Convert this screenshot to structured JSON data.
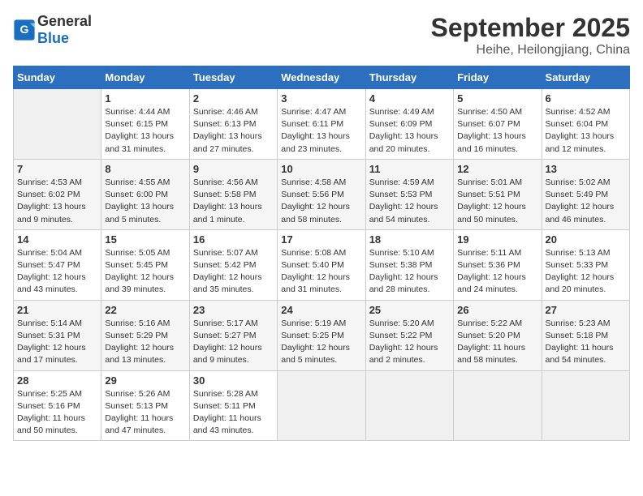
{
  "header": {
    "logo_general": "General",
    "logo_blue": "Blue",
    "month_year": "September 2025",
    "location": "Heihe, Heilongjiang, China"
  },
  "days_of_week": [
    "Sunday",
    "Monday",
    "Tuesday",
    "Wednesday",
    "Thursday",
    "Friday",
    "Saturday"
  ],
  "weeks": [
    [
      {
        "day": "",
        "info": ""
      },
      {
        "day": "1",
        "info": "Sunrise: 4:44 AM\nSunset: 6:15 PM\nDaylight: 13 hours\nand 31 minutes."
      },
      {
        "day": "2",
        "info": "Sunrise: 4:46 AM\nSunset: 6:13 PM\nDaylight: 13 hours\nand 27 minutes."
      },
      {
        "day": "3",
        "info": "Sunrise: 4:47 AM\nSunset: 6:11 PM\nDaylight: 13 hours\nand 23 minutes."
      },
      {
        "day": "4",
        "info": "Sunrise: 4:49 AM\nSunset: 6:09 PM\nDaylight: 13 hours\nand 20 minutes."
      },
      {
        "day": "5",
        "info": "Sunrise: 4:50 AM\nSunset: 6:07 PM\nDaylight: 13 hours\nand 16 minutes."
      },
      {
        "day": "6",
        "info": "Sunrise: 4:52 AM\nSunset: 6:04 PM\nDaylight: 13 hours\nand 12 minutes."
      }
    ],
    [
      {
        "day": "7",
        "info": "Sunrise: 4:53 AM\nSunset: 6:02 PM\nDaylight: 13 hours\nand 9 minutes."
      },
      {
        "day": "8",
        "info": "Sunrise: 4:55 AM\nSunset: 6:00 PM\nDaylight: 13 hours\nand 5 minutes."
      },
      {
        "day": "9",
        "info": "Sunrise: 4:56 AM\nSunset: 5:58 PM\nDaylight: 13 hours\nand 1 minute."
      },
      {
        "day": "10",
        "info": "Sunrise: 4:58 AM\nSunset: 5:56 PM\nDaylight: 12 hours\nand 58 minutes."
      },
      {
        "day": "11",
        "info": "Sunrise: 4:59 AM\nSunset: 5:53 PM\nDaylight: 12 hours\nand 54 minutes."
      },
      {
        "day": "12",
        "info": "Sunrise: 5:01 AM\nSunset: 5:51 PM\nDaylight: 12 hours\nand 50 minutes."
      },
      {
        "day": "13",
        "info": "Sunrise: 5:02 AM\nSunset: 5:49 PM\nDaylight: 12 hours\nand 46 minutes."
      }
    ],
    [
      {
        "day": "14",
        "info": "Sunrise: 5:04 AM\nSunset: 5:47 PM\nDaylight: 12 hours\nand 43 minutes."
      },
      {
        "day": "15",
        "info": "Sunrise: 5:05 AM\nSunset: 5:45 PM\nDaylight: 12 hours\nand 39 minutes."
      },
      {
        "day": "16",
        "info": "Sunrise: 5:07 AM\nSunset: 5:42 PM\nDaylight: 12 hours\nand 35 minutes."
      },
      {
        "day": "17",
        "info": "Sunrise: 5:08 AM\nSunset: 5:40 PM\nDaylight: 12 hours\nand 31 minutes."
      },
      {
        "day": "18",
        "info": "Sunrise: 5:10 AM\nSunset: 5:38 PM\nDaylight: 12 hours\nand 28 minutes."
      },
      {
        "day": "19",
        "info": "Sunrise: 5:11 AM\nSunset: 5:36 PM\nDaylight: 12 hours\nand 24 minutes."
      },
      {
        "day": "20",
        "info": "Sunrise: 5:13 AM\nSunset: 5:33 PM\nDaylight: 12 hours\nand 20 minutes."
      }
    ],
    [
      {
        "day": "21",
        "info": "Sunrise: 5:14 AM\nSunset: 5:31 PM\nDaylight: 12 hours\nand 17 minutes."
      },
      {
        "day": "22",
        "info": "Sunrise: 5:16 AM\nSunset: 5:29 PM\nDaylight: 12 hours\nand 13 minutes."
      },
      {
        "day": "23",
        "info": "Sunrise: 5:17 AM\nSunset: 5:27 PM\nDaylight: 12 hours\nand 9 minutes."
      },
      {
        "day": "24",
        "info": "Sunrise: 5:19 AM\nSunset: 5:25 PM\nDaylight: 12 hours\nand 5 minutes."
      },
      {
        "day": "25",
        "info": "Sunrise: 5:20 AM\nSunset: 5:22 PM\nDaylight: 12 hours\nand 2 minutes."
      },
      {
        "day": "26",
        "info": "Sunrise: 5:22 AM\nSunset: 5:20 PM\nDaylight: 11 hours\nand 58 minutes."
      },
      {
        "day": "27",
        "info": "Sunrise: 5:23 AM\nSunset: 5:18 PM\nDaylight: 11 hours\nand 54 minutes."
      }
    ],
    [
      {
        "day": "28",
        "info": "Sunrise: 5:25 AM\nSunset: 5:16 PM\nDaylight: 11 hours\nand 50 minutes."
      },
      {
        "day": "29",
        "info": "Sunrise: 5:26 AM\nSunset: 5:13 PM\nDaylight: 11 hours\nand 47 minutes."
      },
      {
        "day": "30",
        "info": "Sunrise: 5:28 AM\nSunset: 5:11 PM\nDaylight: 11 hours\nand 43 minutes."
      },
      {
        "day": "",
        "info": ""
      },
      {
        "day": "",
        "info": ""
      },
      {
        "day": "",
        "info": ""
      },
      {
        "day": "",
        "info": ""
      }
    ]
  ]
}
